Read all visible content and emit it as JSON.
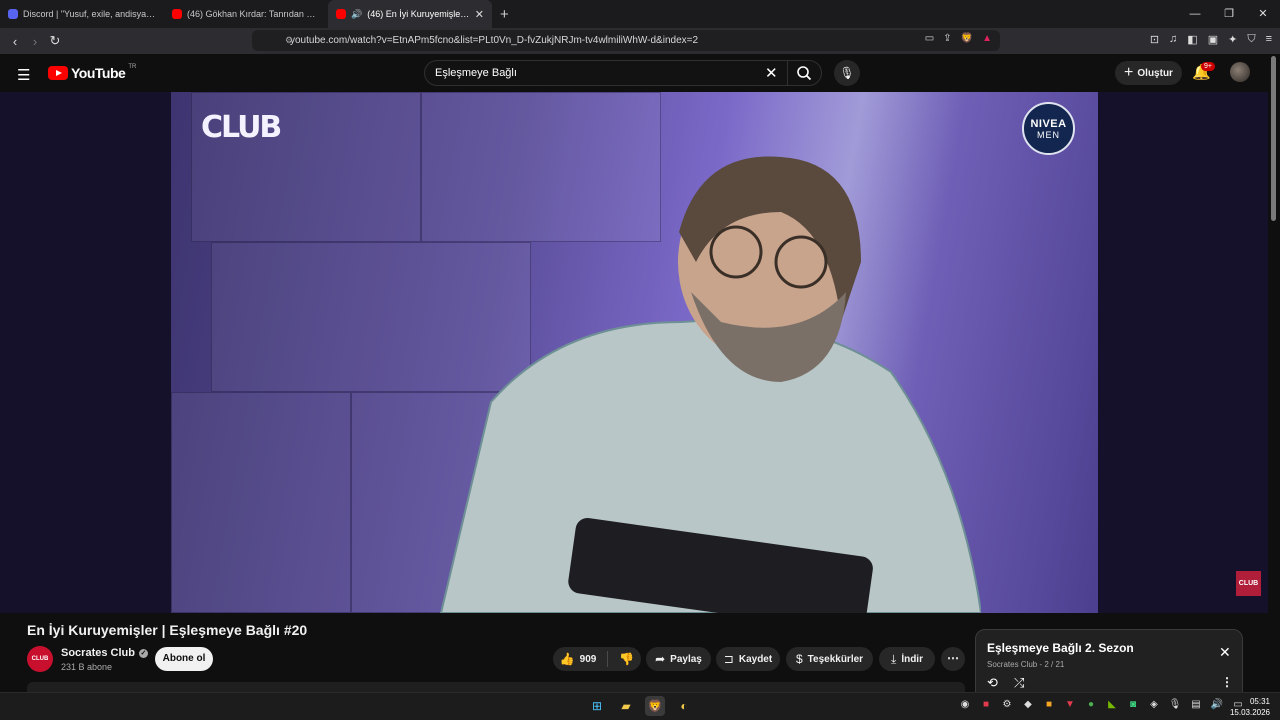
{
  "browser": {
    "tabs": [
      {
        "title": "Discord | \"Yusuf, exile, andisya b…",
        "color": "#5865f2",
        "active": false
      },
      {
        "title": "(46) Gökhan Kırdar: Tanrıdan Diledim…",
        "color": "#ff0000",
        "active": false
      },
      {
        "title": "(46) En İyi Kuruyemişler | Eşleş…",
        "color": "#ff0000",
        "active": true
      }
    ],
    "new_tab": "+",
    "url": "youtube.com/watch?v=EtnAPm5fcno&list=PLt0Vn_D-fvZukjNRJm-tv4wlmiliWhW-d&index=2"
  },
  "header": {
    "logo_text": "YouTube",
    "country": "TR",
    "search_value": "Eşleşmeye Bağlı",
    "create_label": "Oluştur",
    "notif_badge": "9+"
  },
  "video": {
    "overlay_logo": "CLUB",
    "sponsor_top": "NIVEA",
    "sponsor_bottom": "MEN",
    "corner_logo": "CLUB"
  },
  "watch": {
    "title": "En İyi Kuruyemişler | Eşleşmeye Bağlı #20",
    "channel_name": "Socrates Club",
    "channel_avatar_text": "CLUB",
    "subscribers": "231 B abone",
    "subscribe_label": "Abone ol",
    "likes": "909",
    "share_label": "Paylaş",
    "save_label": "Kaydet",
    "thanks_label": "Teşekkürler",
    "download_label": "İndir"
  },
  "playlist": {
    "title": "Eşleşmeye Bağlı 2. Sezon",
    "subtitle": "Socrates Club - 2 / 21"
  },
  "taskbar": {
    "time": "05:31",
    "date": "15.03.2026"
  }
}
